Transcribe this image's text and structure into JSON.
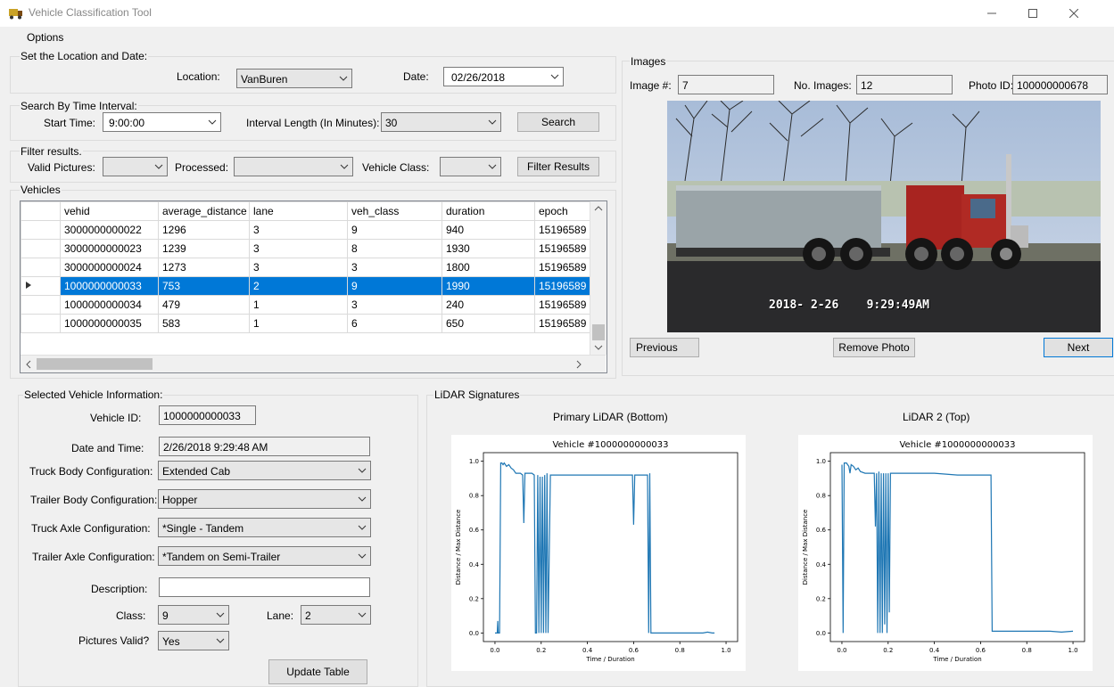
{
  "window": {
    "title": "Vehicle Classification Tool"
  },
  "menu": {
    "options": "Options"
  },
  "location_group": {
    "title": "Set the Location and Date:",
    "location_label": "Location:",
    "location_value": "VanBuren",
    "date_label": "Date:",
    "date_value": "02/26/2018"
  },
  "time_group": {
    "title": "Search By Time Interval:",
    "start_label": "Start Time:",
    "start_value": "9:00:00",
    "interval_label": "Interval Length (In Minutes):",
    "interval_value": "30",
    "search_button": "Search"
  },
  "filter_group": {
    "title": "Filter results.",
    "valid_label": "Valid Pictures:",
    "valid_value": "",
    "processed_label": "Processed:",
    "processed_value": "",
    "class_label": "Vehicle Class:",
    "class_value": "",
    "filter_button": "Filter Results"
  },
  "vehicles": {
    "title": "Vehicles",
    "columns": [
      "vehid",
      "average_distance",
      "lane",
      "veh_class",
      "duration",
      "epoch"
    ],
    "rows": [
      [
        "3000000000022",
        "1296",
        "3",
        "9",
        "940",
        "15196589"
      ],
      [
        "3000000000023",
        "1239",
        "3",
        "8",
        "1930",
        "15196589"
      ],
      [
        "3000000000024",
        "1273",
        "3",
        "3",
        "1800",
        "15196589"
      ],
      [
        "1000000000033",
        "753",
        "2",
        "9",
        "1990",
        "15196589"
      ],
      [
        "1000000000034",
        "479",
        "1",
        "3",
        "240",
        "15196589"
      ],
      [
        "1000000000035",
        "583",
        "1",
        "6",
        "650",
        "15196589"
      ]
    ],
    "selected_row": 3
  },
  "images": {
    "title": "Images",
    "image_num_label": "Image #:",
    "image_num_value": "7",
    "no_images_label": "No. Images:",
    "no_images_value": "12",
    "photo_id_label": "Photo ID:",
    "photo_id_value": "100000000678",
    "timestamp": "2018- 2-26    9:29:49AM",
    "previous_button": "Previous",
    "remove_button": "Remove Photo",
    "next_button": "Next"
  },
  "selected_info": {
    "title": "Selected Vehicle Information:",
    "vehicle_id_label": "Vehicle ID:",
    "vehicle_id_value": "1000000000033",
    "datetime_label": "Date and Time:",
    "datetime_value": "2/26/2018 9:29:48 AM",
    "truck_body_label": "Truck Body Configuration:",
    "truck_body_value": "Extended Cab",
    "trailer_body_label": "Trailer Body Configuration:",
    "trailer_body_value": "Hopper",
    "truck_axle_label": "Truck Axle Configuration:",
    "truck_axle_value": "*Single - Tandem",
    "trailer_axle_label": "Trailer Axle Configuration:",
    "trailer_axle_value": "*Tandem on Semi-Trailer",
    "description_label": "Description:",
    "description_value": "",
    "class_label": "Class:",
    "class_value": "9",
    "lane_label": "Lane:",
    "lane_value": "2",
    "pictures_valid_label": "Pictures Valid?",
    "pictures_valid_value": "Yes",
    "update_button": "Update Table"
  },
  "lidar": {
    "title": "LiDAR Signatures",
    "primary_heading": "Primary LiDAR (Bottom)",
    "secondary_heading": "LiDAR 2 (Top)"
  },
  "chart_data": [
    {
      "type": "line",
      "title": "Vehicle #1000000000033",
      "xlabel": "Time / Duration",
      "ylabel": "Distance / Max Distance",
      "xlim": [
        -0.05,
        1.05
      ],
      "ylim": [
        -0.05,
        1.05
      ],
      "xticks": [
        "0.0",
        "0.2",
        "0.4",
        "0.6",
        "0.8",
        "1.0"
      ],
      "yticks": [
        "0.0",
        "0.2",
        "0.4",
        "0.6",
        "0.8",
        "1.0"
      ],
      "color": "#1f77b4",
      "x": [
        0.0,
        0.01,
        0.012,
        0.014,
        0.02,
        0.025,
        0.03,
        0.035,
        0.04,
        0.05,
        0.06,
        0.07,
        0.08,
        0.09,
        0.1,
        0.11,
        0.12,
        0.125,
        0.13,
        0.135,
        0.14,
        0.15,
        0.16,
        0.17,
        0.175,
        0.18,
        0.185,
        0.19,
        0.195,
        0.2,
        0.205,
        0.21,
        0.215,
        0.22,
        0.225,
        0.23,
        0.24,
        0.3,
        0.4,
        0.5,
        0.58,
        0.595,
        0.6,
        0.605,
        0.62,
        0.66,
        0.665,
        0.67,
        0.675,
        0.68,
        0.8,
        0.9,
        0.92,
        0.94,
        0.95
      ],
      "y": [
        0.0,
        0.0,
        0.07,
        0.0,
        0.0,
        0.99,
        0.99,
        0.98,
        0.99,
        0.97,
        0.98,
        0.96,
        0.95,
        0.93,
        0.93,
        0.93,
        0.92,
        0.64,
        0.93,
        0.93,
        0.93,
        0.93,
        0.93,
        0.92,
        0.0,
        0.0,
        0.92,
        0.0,
        0.91,
        0.0,
        0.91,
        0.0,
        0.92,
        0.0,
        0.93,
        0.0,
        0.92,
        0.92,
        0.92,
        0.92,
        0.92,
        0.92,
        0.63,
        0.92,
        0.92,
        0.92,
        0.0,
        0.93,
        0.0,
        0.0,
        0.0,
        0.0,
        0.005,
        0.0,
        0.0
      ]
    },
    {
      "type": "line",
      "title": "Vehicle #1000000000033",
      "xlabel": "Time / Duration",
      "ylabel": "Distance / Max Distance",
      "xlim": [
        -0.05,
        1.05
      ],
      "ylim": [
        -0.05,
        1.05
      ],
      "xticks": [
        "0.0",
        "0.2",
        "0.4",
        "0.6",
        "0.8",
        "1.0"
      ],
      "yticks": [
        "0.0",
        "0.2",
        "0.4",
        "0.6",
        "0.8",
        "1.0"
      ],
      "color": "#1f77b4",
      "x": [
        0.0,
        0.005,
        0.01,
        0.02,
        0.03,
        0.035,
        0.04,
        0.05,
        0.06,
        0.07,
        0.08,
        0.1,
        0.12,
        0.14,
        0.145,
        0.15,
        0.155,
        0.16,
        0.165,
        0.17,
        0.175,
        0.18,
        0.185,
        0.19,
        0.195,
        0.2,
        0.205,
        0.21,
        0.3,
        0.4,
        0.5,
        0.6,
        0.645,
        0.65,
        0.7,
        0.8,
        0.9,
        0.95,
        1.0
      ],
      "y": [
        0.98,
        0.0,
        0.99,
        0.99,
        0.97,
        0.93,
        0.98,
        0.97,
        0.95,
        0.96,
        0.94,
        0.93,
        0.93,
        0.93,
        0.62,
        0.93,
        0.0,
        0.94,
        0.0,
        0.93,
        0.0,
        0.93,
        0.05,
        0.93,
        0.0,
        0.93,
        0.12,
        0.93,
        0.93,
        0.93,
        0.92,
        0.92,
        0.92,
        0.01,
        0.01,
        0.01,
        0.01,
        0.005,
        0.01
      ]
    }
  ]
}
